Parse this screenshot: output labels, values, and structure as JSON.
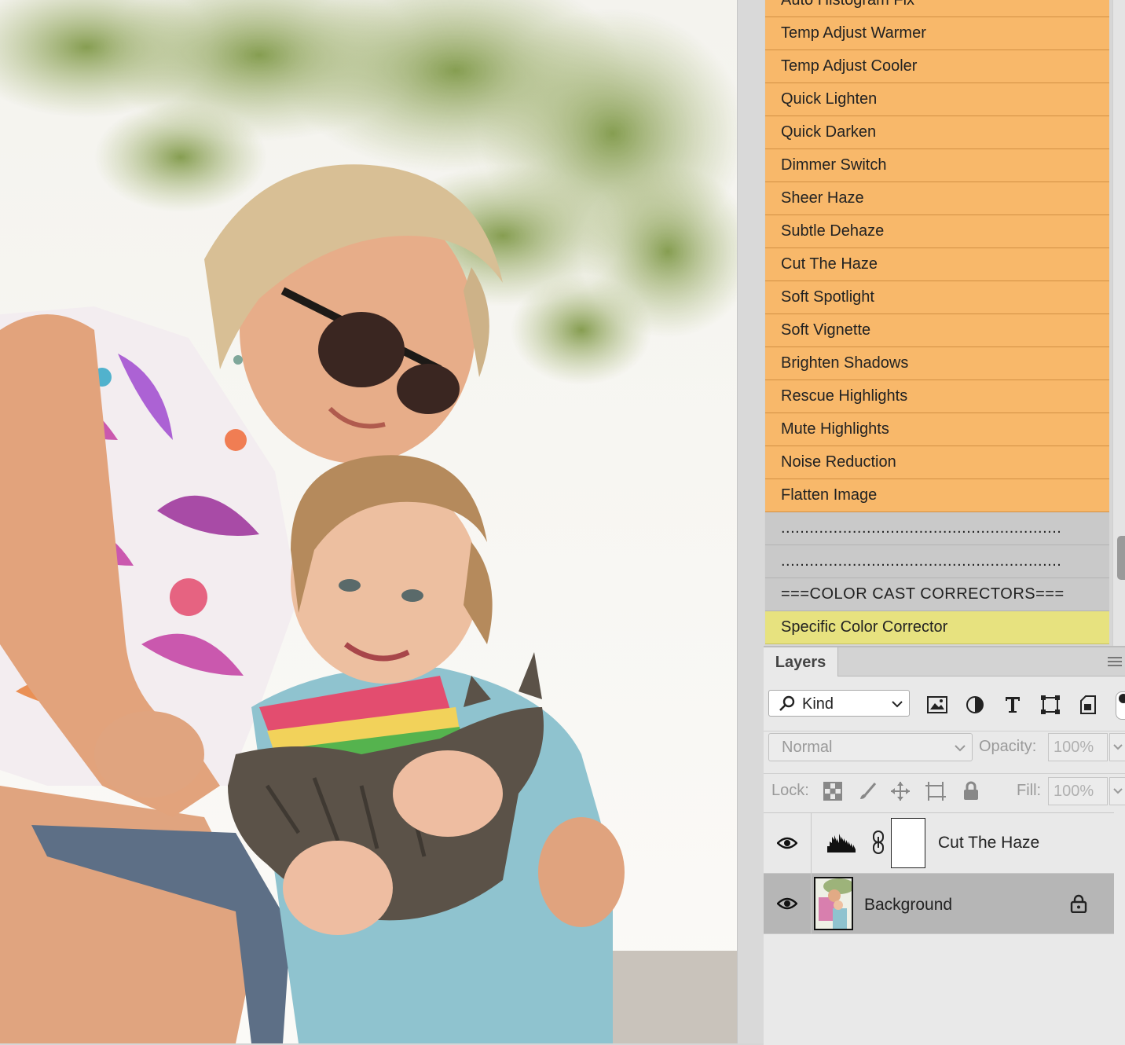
{
  "actions": [
    {
      "label": "Auto Histogram Fix",
      "kind": "orange"
    },
    {
      "label": "Temp Adjust Warmer",
      "kind": "orange"
    },
    {
      "label": "Temp Adjust Cooler",
      "kind": "orange"
    },
    {
      "label": "Quick Lighten",
      "kind": "orange"
    },
    {
      "label": "Quick Darken",
      "kind": "orange"
    },
    {
      "label": "Dimmer Switch",
      "kind": "orange"
    },
    {
      "label": "Sheer Haze",
      "kind": "orange"
    },
    {
      "label": "Subtle Dehaze",
      "kind": "orange"
    },
    {
      "label": "Cut The Haze",
      "kind": "orange"
    },
    {
      "label": "Soft Spotlight",
      "kind": "orange"
    },
    {
      "label": "Soft Vignette",
      "kind": "orange"
    },
    {
      "label": "Brighten Shadows",
      "kind": "orange"
    },
    {
      "label": "Rescue Highlights",
      "kind": "orange"
    },
    {
      "label": "Mute Highlights",
      "kind": "orange"
    },
    {
      "label": "Noise Reduction",
      "kind": "orange"
    },
    {
      "label": "Flatten Image",
      "kind": "orange"
    },
    {
      "label": "...........................................................",
      "kind": "gray"
    },
    {
      "label": "...........................................................",
      "kind": "gray"
    },
    {
      "label": "===COLOR CAST CORRECTORS===",
      "kind": "gray"
    },
    {
      "label": "Specific Color Corrector",
      "kind": "yellow"
    }
  ],
  "colors": {
    "orange": "#f8b86a",
    "gray": "#c9c9c9",
    "yellow": "#e7e27f"
  },
  "layers_panel": {
    "tab_label": "Layers",
    "filter_kind": "Kind",
    "blend_mode": "Normal",
    "opacity_label": "Opacity:",
    "opacity_value": "100%",
    "lock_label": "Lock:",
    "fill_label": "Fill:",
    "fill_value": "100%",
    "layers": [
      {
        "name": "Cut The Haze",
        "type": "levels-adjustment",
        "visible": true,
        "selected": false
      },
      {
        "name": "Background",
        "type": "image",
        "visible": true,
        "selected": true,
        "locked": true
      }
    ]
  }
}
